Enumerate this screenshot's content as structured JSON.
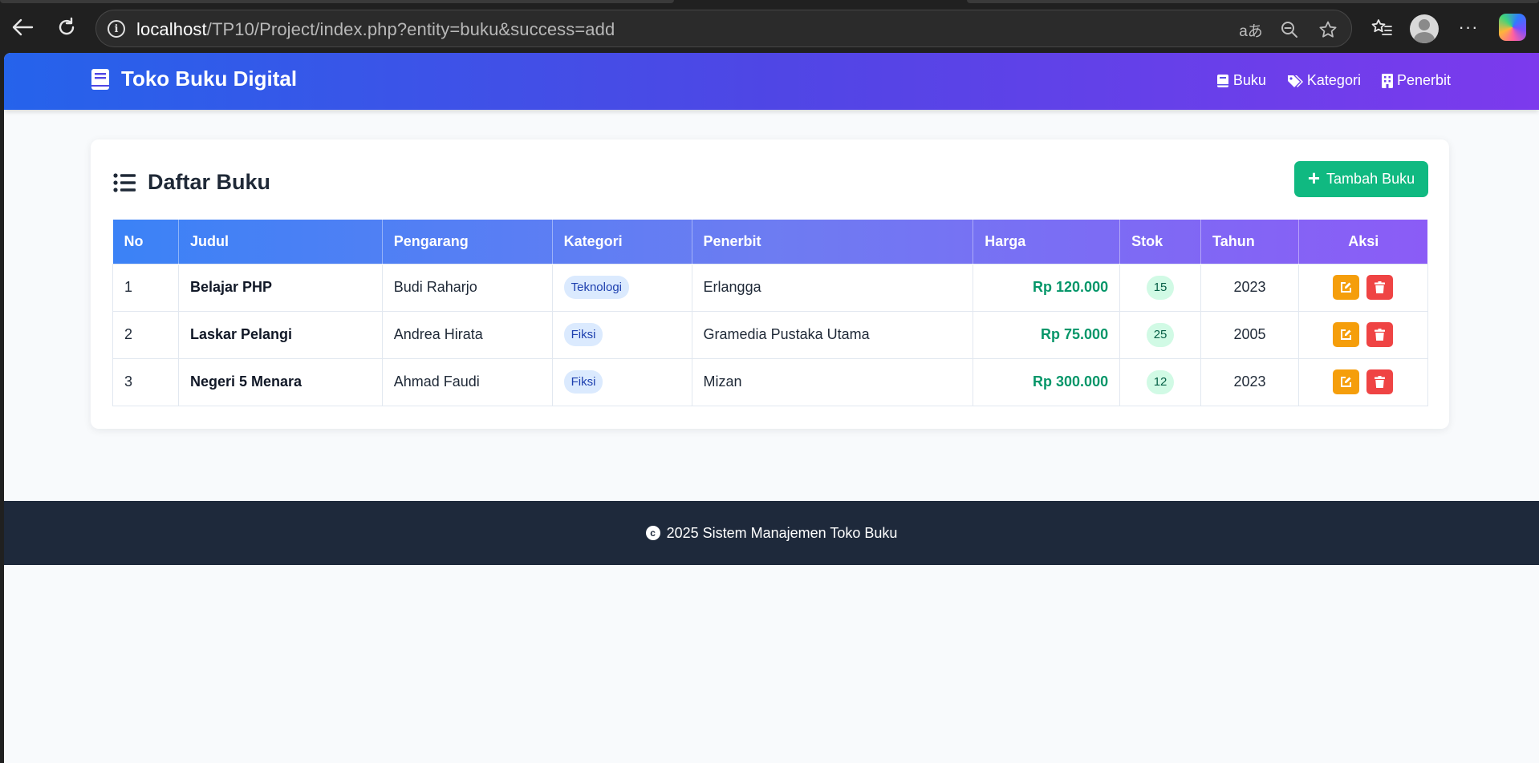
{
  "browser": {
    "url_host": "localhost",
    "url_path": "/TP10/Project/index.php?entity=buku&success=add"
  },
  "app": {
    "brand": "Toko Buku Digital",
    "nav": [
      {
        "label": "Buku",
        "icon": "book-icon"
      },
      {
        "label": "Kategori",
        "icon": "tags-icon"
      },
      {
        "label": "Penerbit",
        "icon": "building-icon"
      }
    ]
  },
  "main": {
    "title": "Daftar Buku",
    "add_button": "Tambah Buku",
    "table": {
      "columns": [
        "No",
        "Judul",
        "Pengarang",
        "Kategori",
        "Penerbit",
        "Harga",
        "Stok",
        "Tahun",
        "Aksi"
      ],
      "rows": [
        {
          "no": "1",
          "judul": "Belajar PHP",
          "pengarang": "Budi Raharjo",
          "kategori": "Teknologi",
          "penerbit": "Erlangga",
          "harga": "Rp 120.000",
          "stok": "15",
          "tahun": "2023"
        },
        {
          "no": "2",
          "judul": "Laskar Pelangi",
          "pengarang": "Andrea Hirata",
          "kategori": "Fiksi",
          "penerbit": "Gramedia Pustaka Utama",
          "harga": "Rp 75.000",
          "stok": "25",
          "tahun": "2005"
        },
        {
          "no": "3",
          "judul": "Negeri 5 Menara",
          "pengarang": "Ahmad Faudi",
          "kategori": "Fiksi",
          "penerbit": "Mizan",
          "harga": "Rp 300.000",
          "stok": "12",
          "tahun": "2023"
        }
      ]
    }
  },
  "footer": {
    "text": "2025 Sistem Manajemen Toko Buku"
  },
  "colors": {
    "header_gradient_start": "#2563eb",
    "header_gradient_end": "#7c3aed",
    "add_button": "#10b981",
    "price": "#059669",
    "edit_button": "#f59e0b",
    "delete_button": "#ef4444",
    "footer_bg": "#1e293b"
  }
}
